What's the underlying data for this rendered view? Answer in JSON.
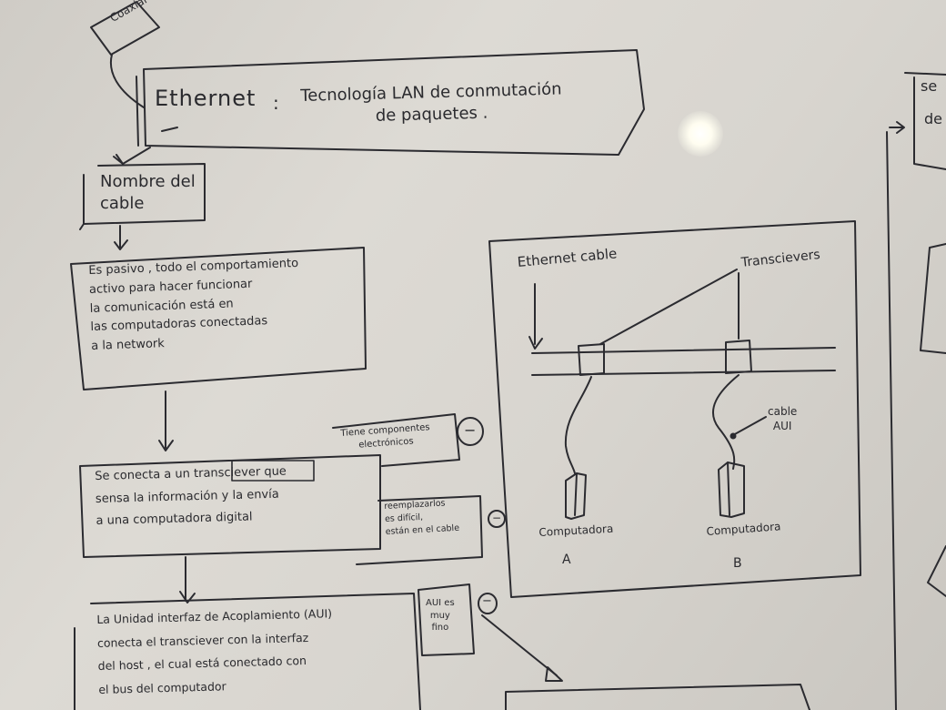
{
  "whiteboard": {
    "tag_coaxial": "Coaxial",
    "title_left": "Ethernet",
    "title_colon": ":",
    "title_right": "Tecnología LAN de conmutación\nde paquetes .",
    "cable_name": "Nombre del\ncable",
    "passive_note": "Es pasivo , todo el comportamiento\nactivo para hacer funcionar\nla comunicación está en\nlas computadoras conectadas\na la network",
    "transceiver_note": "Se conecta a un transciever que\nsensa la información y la envía\na una computadora digital",
    "electronic_note": "Tiene componentes\nelectrónicos",
    "replace_note": "reemplazarlos\nes difícil,\nestán en el cable",
    "minus_1": "−",
    "minus_2": "−",
    "minus_3": "−",
    "aui_note": "La Unidad interfaz de Acoplamiento (AUI)\nconecta el transciever con la interfaz\ndel host , el cual está conectado con\nel bus del computador",
    "aui_fino": "AUI es\nmuy\nfino",
    "diagram": {
      "ethernet_cable": "Ethernet cable",
      "transcievers": "Transcievers",
      "cable_aui": "cable\nAUI",
      "computer_a": "Computadora",
      "letter_a": "A",
      "computer_b": "Computadora",
      "letter_b": "B"
    },
    "right_edge_1": "se",
    "right_edge_2": "de"
  }
}
